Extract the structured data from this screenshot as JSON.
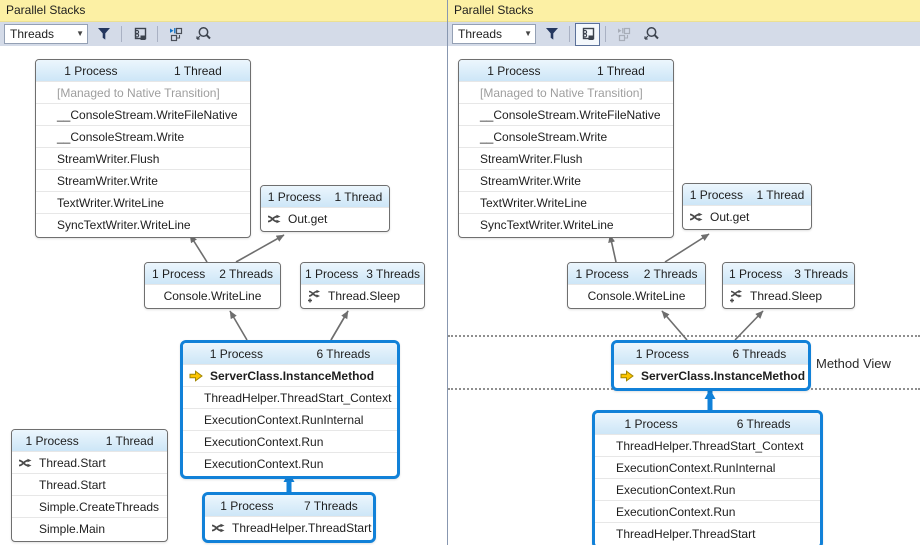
{
  "colors": {
    "selection_blue": "#1181d8",
    "titlebar_yellow": "#fcf0a4",
    "toolbar_gray": "#d4dbe8",
    "arrow_gray": "#6e6e6e",
    "box_header_blue": "#cde6f7",
    "current_frame_arrow_yellow": "#fdc500"
  },
  "icons": {
    "filter": "filter-funnel-icon",
    "method_view": "method-view-toggle-icon",
    "autoscroll": "autoscroll-current-frame-icon",
    "zoom": "zoom-magnifier-icon",
    "chevron": "chevron-down-icon",
    "external_frames": "zigzag-threads-icon",
    "external_frames_plus": "zigzag-threads-plus-icon",
    "current_frame": "current-frame-yellow-arrow-icon"
  },
  "left": {
    "title": "Parallel Stacks",
    "toolbar": {
      "threads": "Threads"
    },
    "boxes": {
      "output": {
        "process": "1 Process",
        "threads": "1 Thread",
        "frames": [
          "[Managed to Native Transition]",
          "__ConsoleStream.WriteFileNative",
          "__ConsoleStream.Write",
          "StreamWriter.Flush",
          "StreamWriter.Write",
          "TextWriter.WriteLine",
          "SyncTextWriter.WriteLine"
        ]
      },
      "out_get": {
        "process": "1 Process",
        "threads": "1 Thread",
        "frame": "Out.get"
      },
      "console_writeline": {
        "process": "1 Process",
        "threads": "2 Threads",
        "frame": "Console.WriteLine"
      },
      "thread_sleep": {
        "process": "1 Process",
        "threads": "3 Threads",
        "frame": "Thread.Sleep"
      },
      "server": {
        "process": "1 Process",
        "threads": "6 Threads",
        "frames": [
          "ServerClass.InstanceMethod",
          "ThreadHelper.ThreadStart_Context",
          "ExecutionContext.RunInternal",
          "ExecutionContext.Run",
          "ExecutionContext.Run"
        ]
      },
      "main": {
        "process": "1 Process",
        "threads": "1 Thread",
        "frames": [
          "Thread.Start",
          "Thread.Start",
          "Simple.CreateThreads",
          "Simple.Main"
        ]
      },
      "thread_start": {
        "process": "1 Process",
        "threads": "7 Threads",
        "frame": "ThreadHelper.ThreadStart"
      }
    }
  },
  "right": {
    "title": "Parallel Stacks",
    "toolbar": {
      "threads": "Threads"
    },
    "method_view_label": "Method View",
    "boxes": {
      "output": {
        "process": "1 Process",
        "threads": "1 Thread",
        "frames": [
          "[Managed to Native Transition]",
          "__ConsoleStream.WriteFileNative",
          "__ConsoleStream.Write",
          "StreamWriter.Flush",
          "StreamWriter.Write",
          "TextWriter.WriteLine",
          "SyncTextWriter.WriteLine"
        ]
      },
      "out_get": {
        "process": "1 Process",
        "threads": "1 Thread",
        "frame": "Out.get"
      },
      "console_writeline": {
        "process": "1 Process",
        "threads": "2 Threads",
        "frame": "Console.WriteLine"
      },
      "thread_sleep": {
        "process": "1 Process",
        "threads": "3 Threads",
        "frame": "Thread.Sleep"
      },
      "method": {
        "process": "1 Process",
        "threads": "6 Threads",
        "frame": "ServerClass.InstanceMethod"
      },
      "callers": {
        "process": "1 Process",
        "threads": "6 Threads",
        "frames": [
          "ThreadHelper.ThreadStart_Context",
          "ExecutionContext.RunInternal",
          "ExecutionContext.Run",
          "ExecutionContext.Run",
          "ThreadHelper.ThreadStart"
        ]
      }
    }
  }
}
